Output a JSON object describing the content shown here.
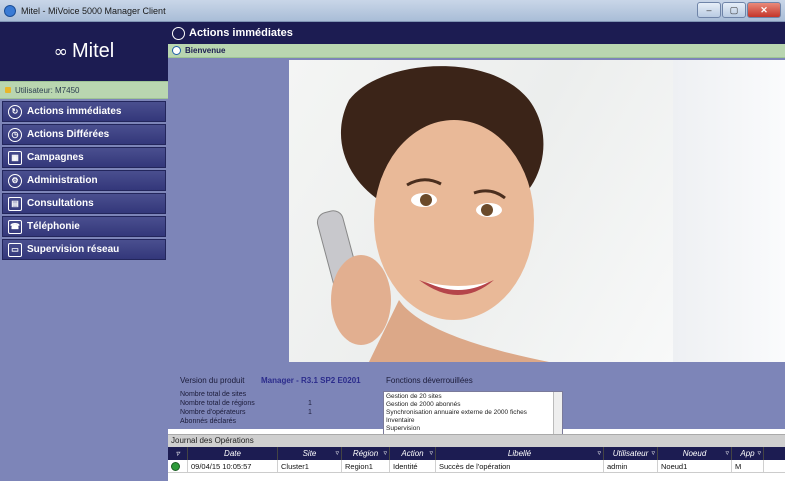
{
  "window": {
    "title": "Mitel - MiVoice 5000 Manager Client",
    "min": "–",
    "max": "▢",
    "close": "✕"
  },
  "sidebar": {
    "logo": "Mitel",
    "user": "Utilisateur: M7450",
    "items": [
      {
        "label": "Actions immédiates",
        "icon": "refresh-icon"
      },
      {
        "label": "Actions Différées",
        "icon": "clock-icon"
      },
      {
        "label": "Campagnes",
        "icon": "campaign-icon"
      },
      {
        "label": "Administration",
        "icon": "wrench-icon"
      },
      {
        "label": "Consultations",
        "icon": "book-icon"
      },
      {
        "label": "Téléphonie",
        "icon": "phone-icon"
      },
      {
        "label": "Supervision réseau",
        "icon": "monitor-icon"
      }
    ]
  },
  "main": {
    "title": "Actions immédiates",
    "subtitle": "Bienvenue"
  },
  "info": {
    "version_label": "Version du produit",
    "version_value": "Manager - R3.1 SP2 E0201",
    "features_label": "Fonctions déverrouillées",
    "stats": [
      {
        "label": "Nombre total de sites",
        "value": ""
      },
      {
        "label": "Nombre total de régions",
        "value": "1"
      },
      {
        "label": "Nombre d'opérateurs",
        "value": "1"
      },
      {
        "label": "Abonnés déclarés",
        "value": ""
      }
    ],
    "features": [
      "Gestion de 20 sites",
      "Gestion de 2000 abonnés",
      "Synchronisation annuaire externe de 2000 fiches",
      "Inventaire",
      "Supervision"
    ]
  },
  "journal": {
    "title": "Journal des Opérations",
    "columns": [
      "Date",
      "Site",
      "Région",
      "Action",
      "Libellé",
      "Utilisateur",
      "Noeud",
      "App"
    ],
    "rows": [
      {
        "date": "09/04/15 10:05:57",
        "site": "Cluster1",
        "region": "Region1",
        "action": "Identité",
        "libelle": "Succès de l'opération",
        "user": "admin",
        "node": "Noeud1",
        "app": "M"
      }
    ]
  }
}
